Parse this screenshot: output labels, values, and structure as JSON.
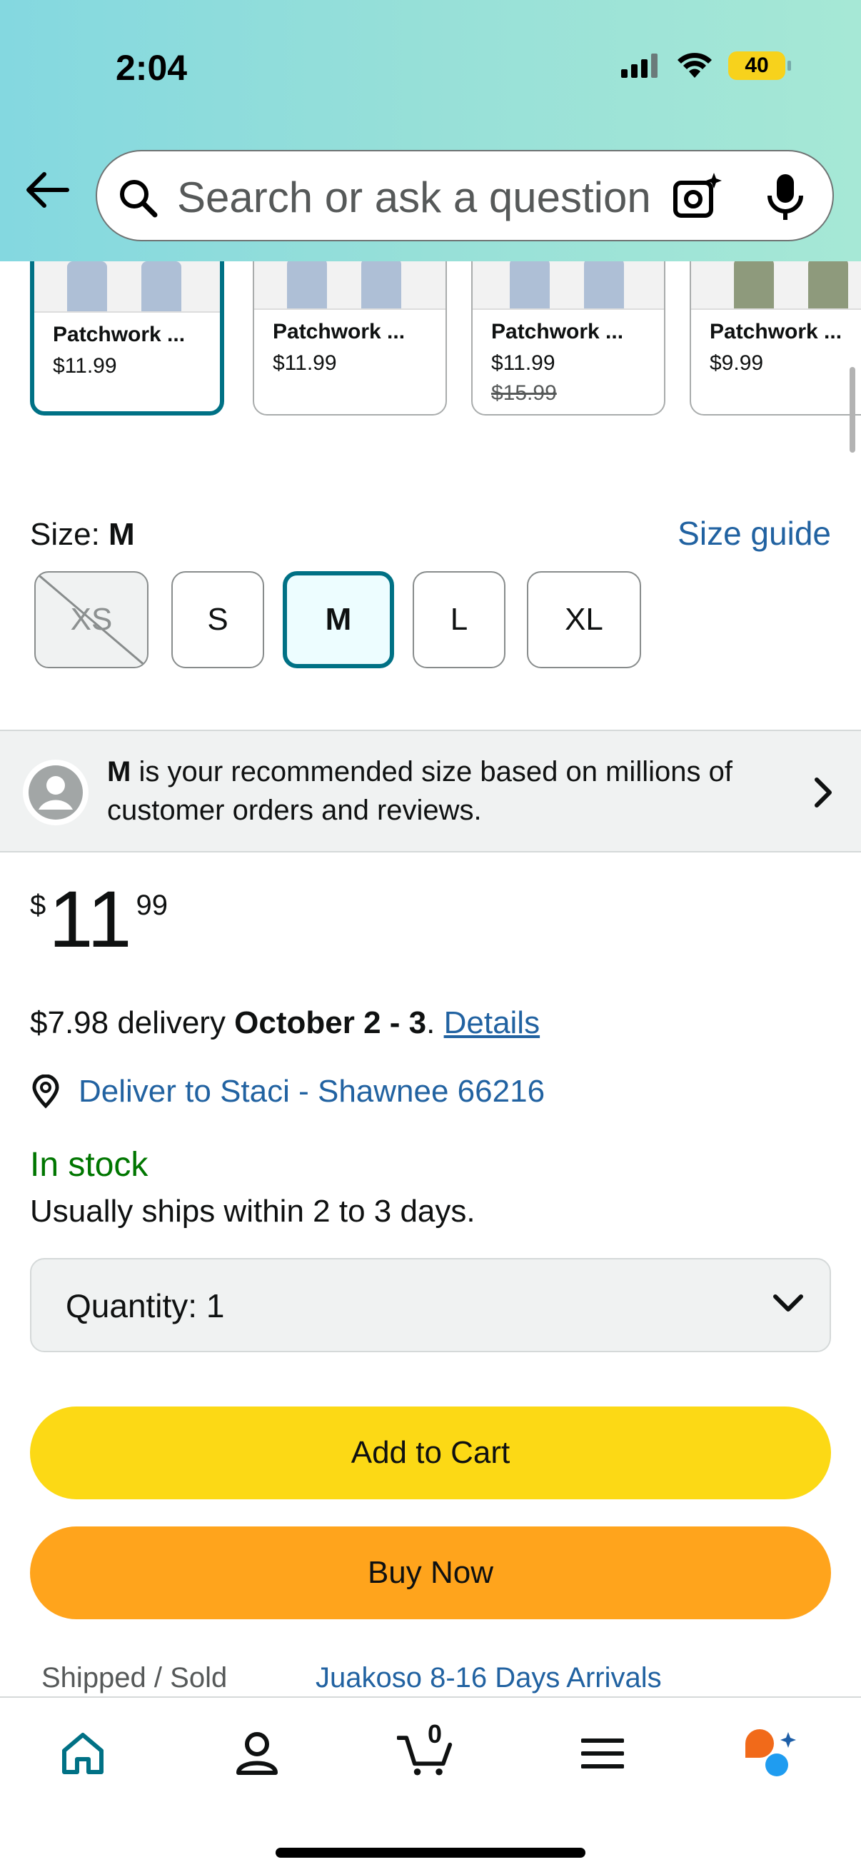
{
  "status_bar": {
    "time": "2:04",
    "battery": "40"
  },
  "search": {
    "placeholder": "Search or ask a question"
  },
  "variants": [
    {
      "title": "Patchwork ...",
      "price": "$11.99",
      "old_price": ""
    },
    {
      "title": "Patchwork ...",
      "price": "$11.99",
      "old_price": ""
    },
    {
      "title": "Patchwork ...",
      "price": "$11.99",
      "old_price": "$15.99"
    },
    {
      "title": "Patchwork ...",
      "price": "$9.99",
      "old_price": ""
    }
  ],
  "size": {
    "label": "Size: ",
    "selected": "M",
    "guide_link": "Size guide",
    "options": [
      "XS",
      "S",
      "M",
      "L",
      "XL"
    ],
    "unavailable": [
      "XS"
    ]
  },
  "recommendation": {
    "size": "M",
    "text": " is your recommended size based on millions of customer orders and reviews."
  },
  "price": {
    "symbol": "$",
    "whole": "11",
    "fraction": "99"
  },
  "delivery": {
    "prefix": "$7.98 delivery ",
    "dates": "October 2 - 3",
    "suffix": ". ",
    "details_link": "Details"
  },
  "deliver_to": "Deliver to Staci - Shawnee 66216",
  "stock": {
    "status": "In stock",
    "ships": "Usually ships within 2 to 3 days."
  },
  "quantity": {
    "label": "Quantity:  1"
  },
  "buttons": {
    "add_to_cart": "Add to Cart",
    "buy_now": "Buy Now"
  },
  "shipped": {
    "label": "Shipped / Sold",
    "seller": "Juakoso 8-16 Days Arrivals"
  },
  "tabbar": {
    "cart_count": "0"
  },
  "colors": {
    "accent_teal": "#007185",
    "link_blue": "#2162a1",
    "add_to_cart_yellow": "#fcd915",
    "buy_now_orange": "#ffa41c",
    "in_stock_green": "#007600"
  }
}
